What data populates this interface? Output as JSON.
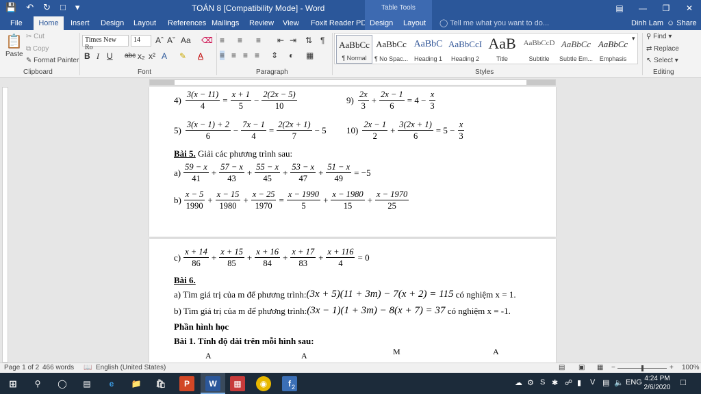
{
  "titlebar": {
    "title": "TOÁN 8 [Compatibility Mode] - Word",
    "context_group": "Table Tools",
    "qat_icons": [
      "save-icon",
      "undo-icon",
      "redo-icon",
      "new-doc-icon",
      "customize-icon"
    ]
  },
  "tabs": {
    "file": "File",
    "home": "Home",
    "insert": "Insert",
    "design": "Design",
    "layout": "Layout",
    "references": "References",
    "mailings": "Mailings",
    "review": "Review",
    "view": "View",
    "foxit": "Foxit Reader PDF",
    "table_design": "Design",
    "table_layout": "Layout",
    "tell_me": "Tell me what you want to do...",
    "user": "Dinh Lam",
    "share": "Share"
  },
  "ribbon": {
    "clipboard": {
      "label": "Clipboard",
      "paste": "Paste",
      "cut": "Cut",
      "copy": "Copy",
      "format_painter": "Format Painter"
    },
    "font": {
      "label": "Font",
      "font_name": "Times New Ro",
      "font_size": "14"
    },
    "paragraph": {
      "label": "Paragraph"
    },
    "styles": {
      "label": "Styles",
      "items": [
        {
          "sample": "AaBbCc",
          "name": "¶ Normal"
        },
        {
          "sample": "AaBbCc",
          "name": "¶ No Spac..."
        },
        {
          "sample": "AaBbC",
          "name": "Heading 1"
        },
        {
          "sample": "AaBbCcI",
          "name": "Heading 2"
        },
        {
          "sample": "AaB",
          "name": "Title"
        },
        {
          "sample": "AaBbCcD",
          "name": "Subtitle"
        },
        {
          "sample": "AaBbCc",
          "name": "Subtle Em..."
        },
        {
          "sample": "AaBbCc",
          "name": "Emphasis"
        }
      ]
    },
    "editing": {
      "label": "Editing",
      "find": "Find",
      "replace": "Replace",
      "select": "Select"
    }
  },
  "document": {
    "eq4_num": "4)",
    "eq9_num": "9)",
    "eq5_num": "5)",
    "eq10_num": "10)",
    "bai5_title": "Bài 5.",
    "bai5_text": "Giải các phương trình sau:",
    "a_label": "a)",
    "b_label": "b)",
    "c_label": "c)",
    "bai6_title": "Bài 6.",
    "bai6_a_text": "a) Tìm giá trị của m để phương trình:",
    "bai6_a_eq": "(3x + 5)(11 + 3m) − 7(x + 2) = 115",
    "bai6_a_tail": "có nghiệm x = 1.",
    "bai6_b_text": "b) Tìm giá trị của m để phương trình:",
    "bai6_b_eq": "(3x − 1)(1 + 3m) − 8(x + 7) = 37",
    "bai6_b_tail": "có nghiệm x = -1.",
    "section_title": "Phần hình học",
    "bai1_title": "Bài 1. Tính độ dài trên mỗi hình sau:",
    "figure_labels": [
      "A",
      "A",
      "M",
      "A"
    ]
  },
  "statusbar": {
    "page": "Page 1 of 2",
    "words": "466 words",
    "language": "English (United States)",
    "zoom": "100%"
  },
  "taskbar": {
    "time": "4:24 PM",
    "date": "2/6/2020",
    "lang": "ENG",
    "notification_count": "2"
  }
}
